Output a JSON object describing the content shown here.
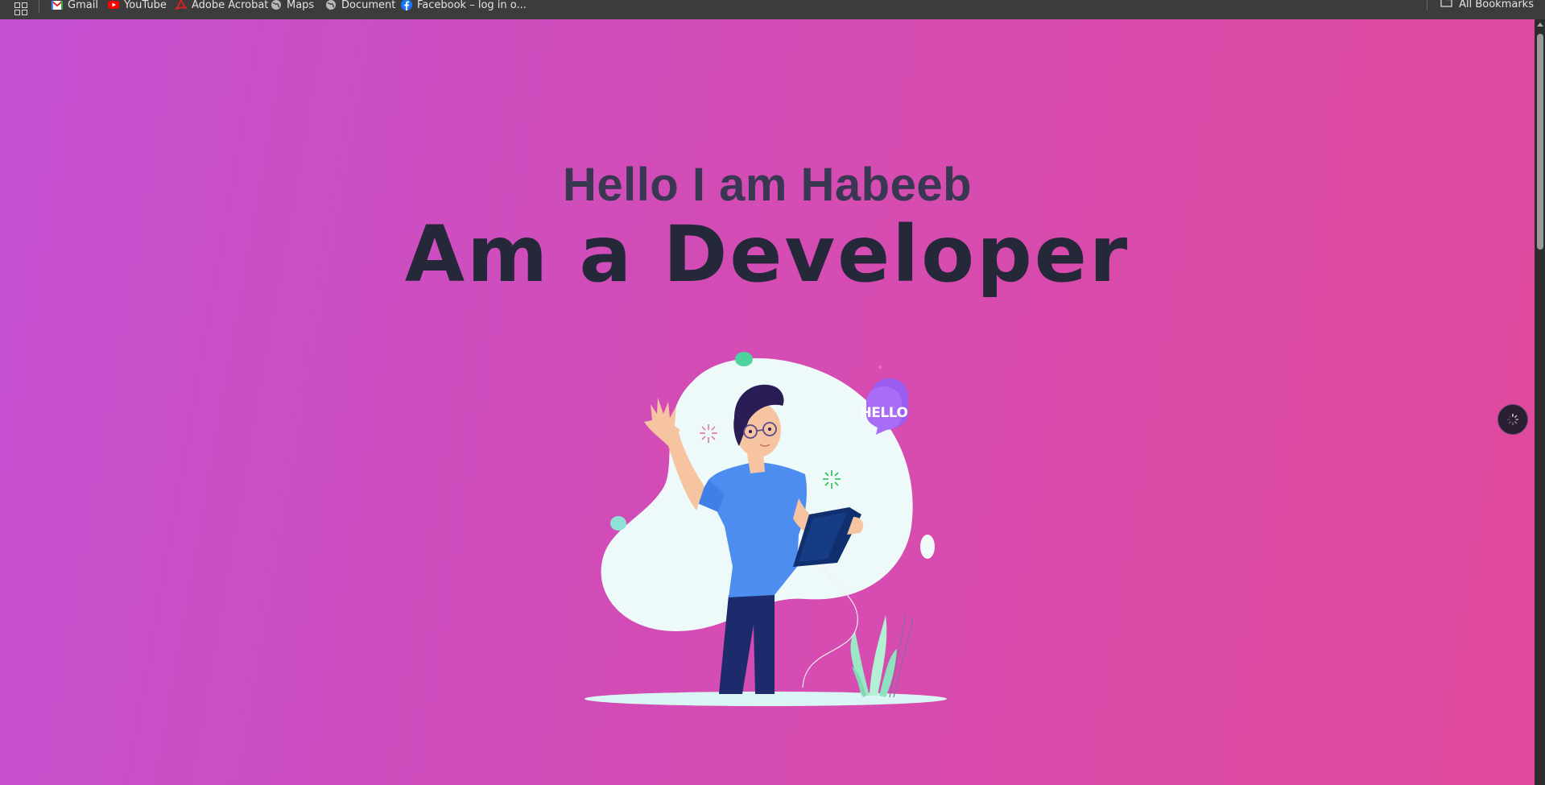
{
  "bookmarks": {
    "items": [
      {
        "label": "Gmail",
        "icon": "gmail-icon"
      },
      {
        "label": "YouTube",
        "icon": "youtube-icon"
      },
      {
        "label": "Adobe Acrobat",
        "icon": "acrobat-icon"
      },
      {
        "label": "Maps",
        "icon": "globe-icon"
      },
      {
        "label": "Document",
        "icon": "globe-icon"
      },
      {
        "label": "Facebook – log in o...",
        "icon": "facebook-icon"
      }
    ],
    "all_label": "All Bookmarks"
  },
  "hero": {
    "greeting": "Hello I am Habeeb",
    "title": "Am a Developer",
    "bubble_text": "HELLO"
  },
  "colors": {
    "gradient_start": "#c451d2",
    "gradient_end": "#e04a9c",
    "heading_dark": "#242838"
  }
}
